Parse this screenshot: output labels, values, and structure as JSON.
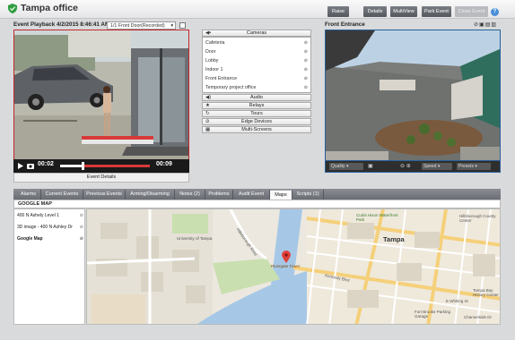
{
  "header": {
    "title": "Tampa office",
    "buttons": [
      {
        "label": "Raise",
        "enabled": true
      },
      {
        "label": "Details",
        "enabled": true
      },
      {
        "label": "MultiView",
        "enabled": true
      },
      {
        "label": "Park Event",
        "enabled": true
      },
      {
        "label": "Close Event",
        "enabled": false
      }
    ],
    "help": "?"
  },
  "playback": {
    "title": "Event Playback 4/2/2015 8:46:41 AM",
    "camera_select": "1/1 Front Door(Recorded)",
    "time_elapsed": "00:02",
    "time_total": "00:09",
    "progress": 0.25,
    "event_details": "Event Details"
  },
  "middle": {
    "cameras_label": "Cameras",
    "cameras": [
      "Cafeteria",
      "Door",
      "Lobby",
      "Indoor 1",
      "Front Entrance",
      "Temporary project office"
    ],
    "sections": [
      "Audio",
      "Relays",
      "Tours",
      "Edge Devices",
      "Multi-Screens"
    ]
  },
  "front": {
    "title": "Front Entrance",
    "quality": "Quality",
    "speed": "Speed",
    "presets": "Presets"
  },
  "tabs": [
    "Alarms",
    "Current Events",
    "Previous Events",
    "Arming/Disarming",
    "Notes (2)",
    "Problems",
    "Audit Event",
    "Maps",
    "Scripts (1)"
  ],
  "active_tab": "Maps",
  "maps": {
    "header": "GOOGLE MAP",
    "items": [
      "400 N Ashely Level 1",
      "3D image - 400 N Ashley Dr",
      "Google Map"
    ],
    "labels": {
      "city": "Tampa",
      "river": "Hillsborough River",
      "tower": "Rivergate Tower",
      "kennedy": "Kennedy Blvd",
      "fort": "Fort Brooke Parking Garage",
      "county": "Hillsborough County Center",
      "history": "Tampa Bay History Center",
      "eastwhiting": "E Whiting St",
      "channelside": "Channelside Dr",
      "park": "Curtis Hixon Waterfront Park",
      "ut": "University of Tampa"
    }
  },
  "colors": {
    "playback_border": "#c0272d",
    "camera_border": "#2a5f9a",
    "shield": "#2f9e3f",
    "marker": "#e0403a"
  }
}
